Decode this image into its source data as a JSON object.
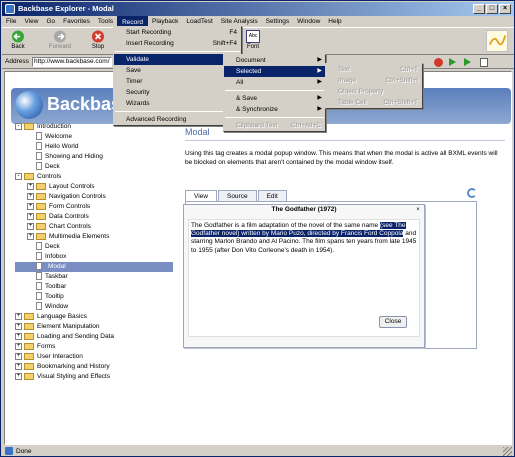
{
  "window": {
    "title": "Backbase Explorer - Modal"
  },
  "menubar": [
    "File",
    "View",
    "Go",
    "Favorites",
    "Tools",
    "Record",
    "Playback",
    "LoadTest",
    "Site Analysis",
    "Settings",
    "Window",
    "Help"
  ],
  "toolbar": {
    "back": "Back",
    "forward": "Forward",
    "stop": "Stop",
    "font": "Font",
    "font_icon": "Abc"
  },
  "address": {
    "label": "Address",
    "value": "http://www.backbase.com/"
  },
  "status": {
    "text": "Done"
  },
  "page": {
    "brand": "Backbase",
    "tree": [
      {
        "label": "Introduction",
        "type": "folder",
        "level": 0,
        "exp": "-"
      },
      {
        "label": "Welcome",
        "type": "doc",
        "level": 1
      },
      {
        "label": "Hello World",
        "type": "doc",
        "level": 1
      },
      {
        "label": "Showing and Hiding",
        "type": "doc",
        "level": 1
      },
      {
        "label": "Deck",
        "type": "doc",
        "level": 1
      },
      {
        "label": "Controls",
        "type": "folder",
        "level": 0,
        "exp": "-"
      },
      {
        "label": "Layout Controls",
        "type": "folder",
        "level": 1,
        "exp": "+"
      },
      {
        "label": "Navigation Controls",
        "type": "folder",
        "level": 1,
        "exp": "+"
      },
      {
        "label": "Form Controls",
        "type": "folder",
        "level": 1,
        "exp": "+"
      },
      {
        "label": "Data Controls",
        "type": "folder",
        "level": 1,
        "exp": "+"
      },
      {
        "label": "Chart Controls",
        "type": "folder",
        "level": 1,
        "exp": "+"
      },
      {
        "label": "Multimedia Elements",
        "type": "folder",
        "level": 1,
        "exp": "+"
      },
      {
        "label": "Deck",
        "type": "doc",
        "level": 1
      },
      {
        "label": "Infobox",
        "type": "doc",
        "level": 1
      },
      {
        "label": "Modal",
        "type": "doc",
        "level": 1,
        "selected": true
      },
      {
        "label": "Taskbar",
        "type": "doc",
        "level": 1
      },
      {
        "label": "Toolbar",
        "type": "doc",
        "level": 1
      },
      {
        "label": "Tooltip",
        "type": "doc",
        "level": 1
      },
      {
        "label": "Window",
        "type": "doc",
        "level": 1
      },
      {
        "label": "Language Basics",
        "type": "folder",
        "level": 0,
        "exp": "+"
      },
      {
        "label": "Element Manipulation",
        "type": "folder",
        "level": 0,
        "exp": "+"
      },
      {
        "label": "Loading and Sending Data",
        "type": "folder",
        "level": 0,
        "exp": "+"
      },
      {
        "label": "Forms",
        "type": "folder",
        "level": 0,
        "exp": "+"
      },
      {
        "label": "User Interaction",
        "type": "folder",
        "level": 0,
        "exp": "+"
      },
      {
        "label": "Bookmarking and History",
        "type": "folder",
        "level": 0,
        "exp": "+"
      },
      {
        "label": "Visual Styling and Effects",
        "type": "folder",
        "level": 0,
        "exp": "+"
      }
    ],
    "heading": "Modal",
    "description": "Using this tag creates a modal popup window. This means that when the modal is active all BXML events will be blocked on elements that aren't contained by the modal window itself.",
    "tabs": [
      "View",
      "Source",
      "Edit"
    ],
    "modal": {
      "title": "The Godfather (1972)",
      "close_glyph": "×",
      "text_before": "The Godfather is a film adaptation of the novel of the same name ",
      "text_highlight": "(see The Godfather novel) written by Mario Puzo, directed by Francis Ford Coppola",
      "text_after": " and starring Marlon Brando and Al Pacino. The film spans ten years from late 1945 to 1955 (after Don Vito Corleone's death in 1954).",
      "close_button": "Close"
    }
  },
  "record_menu": {
    "items": [
      {
        "label": "Start Recording",
        "shortcut": "F4"
      },
      {
        "label": "Insert Recording",
        "shortcut": "Shift+F4"
      }
    ],
    "items2": [
      {
        "label": "Validate",
        "submenu": true,
        "hover": true
      },
      {
        "label": "Save",
        "submenu": true
      },
      {
        "label": "Timer",
        "submenu": true
      },
      {
        "label": "Security",
        "submenu": true
      },
      {
        "label": "Wizards",
        "submenu": true
      }
    ],
    "items3": [
      {
        "label": "Advanced Recording",
        "submenu": true
      }
    ]
  },
  "validate_menu": {
    "items": [
      {
        "label": "Document",
        "submenu": true
      },
      {
        "label": "Selected",
        "submenu": true,
        "hover": true
      },
      {
        "label": "All",
        "submenu": true
      }
    ],
    "items2": [
      {
        "label": "& Save",
        "submenu": true
      },
      {
        "label": "& Synchronize",
        "submenu": true
      }
    ],
    "items3": [
      {
        "label": "Clipboard Text",
        "shortcut": "Ctrl+Alt+C",
        "disabled": true
      }
    ]
  },
  "selected_menu": {
    "items": [
      {
        "label": "Text",
        "shortcut": "Ctrl+T",
        "disabled": true
      },
      {
        "label": "Image",
        "shortcut": "Ctrl+Shift+I",
        "disabled": true
      },
      {
        "label": "Object Property",
        "disabled": true
      },
      {
        "label": "Table Cell",
        "shortcut": "Ctrl+Shift+T",
        "disabled": true
      }
    ]
  }
}
